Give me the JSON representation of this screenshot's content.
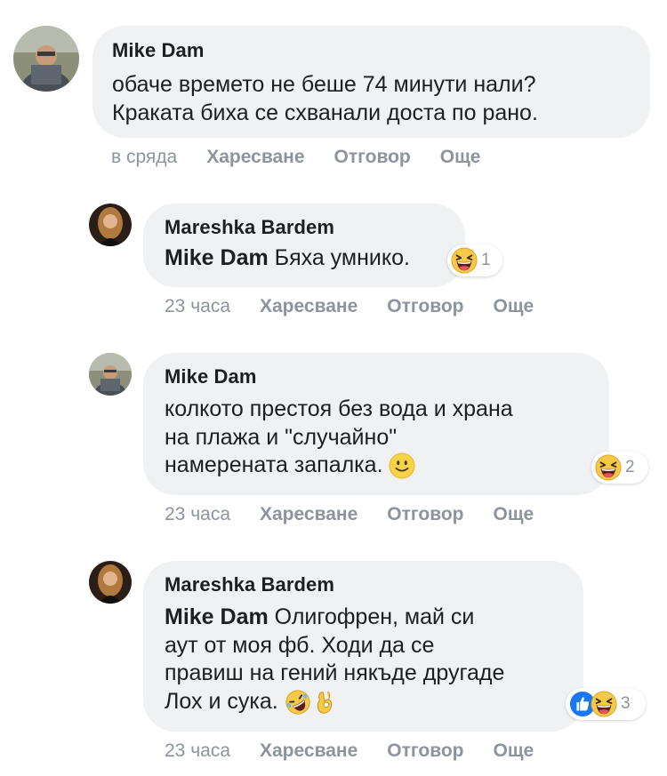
{
  "comments": [
    {
      "author": "Mike Dam",
      "lines": [
        "обаче времето не беше 74 минути нали?",
        "Краката биха се схванали доста по рано."
      ],
      "time": "в сряда",
      "like": "Харесване",
      "reply": "Отговор",
      "more": "Още"
    },
    {
      "author": "Mareshka Bardem",
      "mention": "Mike Dam",
      "text": " Бяха умнико.",
      "reaction_count": "1",
      "reaction_icons": [
        "laugh-icon"
      ],
      "time": "23 часа",
      "like": "Харесване",
      "reply": "Отговор",
      "more": "Още"
    },
    {
      "author": "Mike Dam",
      "lines": [
        "колкото престоя без вода и храна",
        "на плажа и \"случайно\"",
        "намерената запалка."
      ],
      "inline_emoji": "smile-icon",
      "reaction_count": "2",
      "reaction_icons": [
        "laugh-icon"
      ],
      "time": "23 часа",
      "like": "Харесване",
      "reply": "Отговор",
      "more": "Още"
    },
    {
      "author": "Mareshka Bardem",
      "mention": "Mike Dam",
      "first_line_rest": " Олигофрен, май си",
      "lines": [
        "аут от моя фб. Ходи да се",
        "правиш на гений някъде другаде",
        "Лох и сука."
      ],
      "inline_emojis": [
        "rolling-laugh-icon",
        "ok-hand-icon"
      ],
      "reaction_count": "3",
      "reaction_icons": [
        "like-icon",
        "laugh-icon"
      ],
      "time": "23 часа",
      "like": "Харесване",
      "reply": "Отговор",
      "more": "Още"
    }
  ],
  "colors": {
    "bubble": "#f0f1f3",
    "meta_text": "#8d949e",
    "like_blue": "#1877f2",
    "laugh_yellow": "#f7c948"
  }
}
